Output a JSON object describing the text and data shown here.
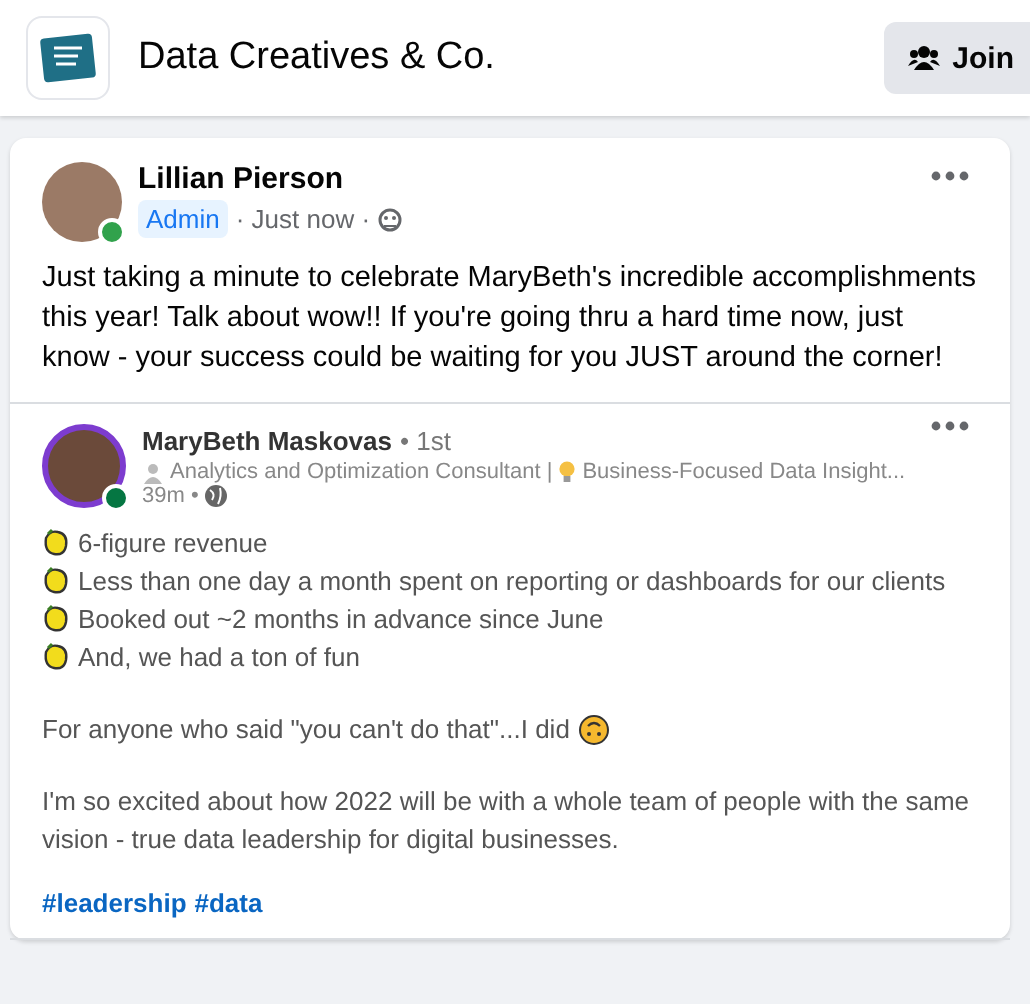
{
  "group": {
    "name": "Data Creatives & Co.",
    "join_label": "Join"
  },
  "post": {
    "author": "Lillian Pierson",
    "online": true,
    "badge": "Admin",
    "time": "· Just now ·",
    "text": "Just taking a minute to celebrate MaryBeth's incredible accomplishments this year! Talk about wow!! If you're going thru a hard time now, just know - your success could be waiting for you JUST around the corner!"
  },
  "shared": {
    "author": "MaryBeth Maskovas",
    "degree": "• 1st",
    "online": true,
    "headline": "Analytics and Optimization Consultant |",
    "headline_more": "Business-Focused Data Insight...",
    "time": "39m •",
    "bullets": [
      "6-figure revenue",
      "Less than one day a month spent on reporting or dashboards for our clients",
      "Booked out ~2 months in advance since June",
      "And, we had a ton of fun"
    ],
    "remark": "For anyone who said \"you can't do that\"...I did",
    "paragraph": "I'm so excited about how 2022 will be with a whole team of people with the same vision - true data leadership for digital businesses.",
    "hashtags": [
      "#leadership",
      "#data"
    ]
  }
}
